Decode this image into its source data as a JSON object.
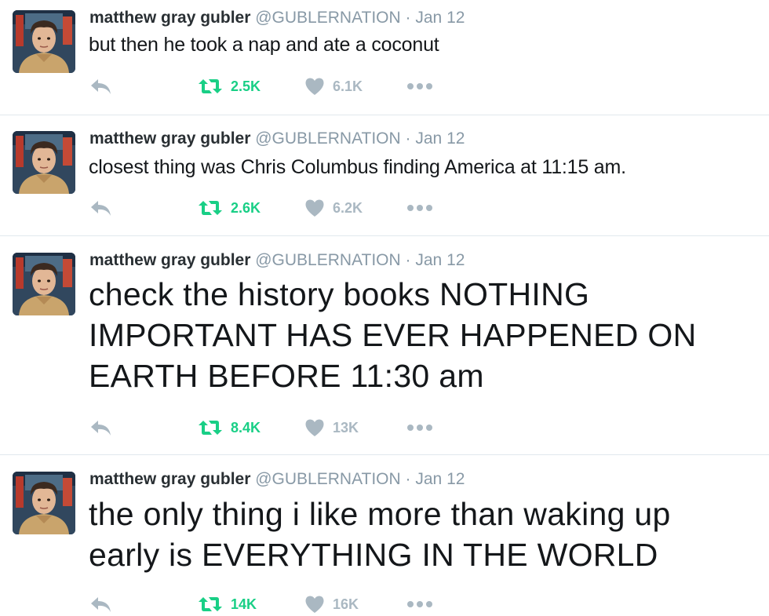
{
  "tweets": [
    {
      "name": "matthew gray gubler",
      "handle": "@GUBLERNATION",
      "separator": "·",
      "date": "Jan 12",
      "text": "but then he took a nap and ate a coconut",
      "retweets": "2.5K",
      "likes": "6.1K"
    },
    {
      "name": "matthew gray gubler",
      "handle": "@GUBLERNATION",
      "separator": "·",
      "date": "Jan 12",
      "text": "closest thing was Chris Columbus finding America at 11:15 am.",
      "retweets": "2.6K",
      "likes": "6.2K"
    },
    {
      "name": "matthew gray gubler",
      "handle": "@GUBLERNATION",
      "separator": "·",
      "date": "Jan 12",
      "text_lines": [
        "check the history books NOTHING",
        "IMPORTANT HAS EVER HAPPENED ON",
        "EARTH BEFORE 11:30 am"
      ],
      "retweets": "8.4K",
      "likes": "13K"
    },
    {
      "name": "matthew gray gubler",
      "handle": "@GUBLERNATION",
      "separator": "·",
      "date": "Jan 12",
      "text_lines": [
        "the only thing i like more than waking up",
        "early is EVERYTHING IN THE WORLD"
      ],
      "retweets": "14K",
      "likes": "16K"
    }
  ],
  "icons": {
    "reply": "reply-arrow-icon",
    "retweet": "retweet-icon",
    "like": "heart-icon",
    "more": "more-dots-icon"
  },
  "colors": {
    "retweet_active": "#19cf86",
    "action_gray": "#aab8c2",
    "handle_gray": "#8899a6",
    "divider": "#e1e8ed"
  }
}
